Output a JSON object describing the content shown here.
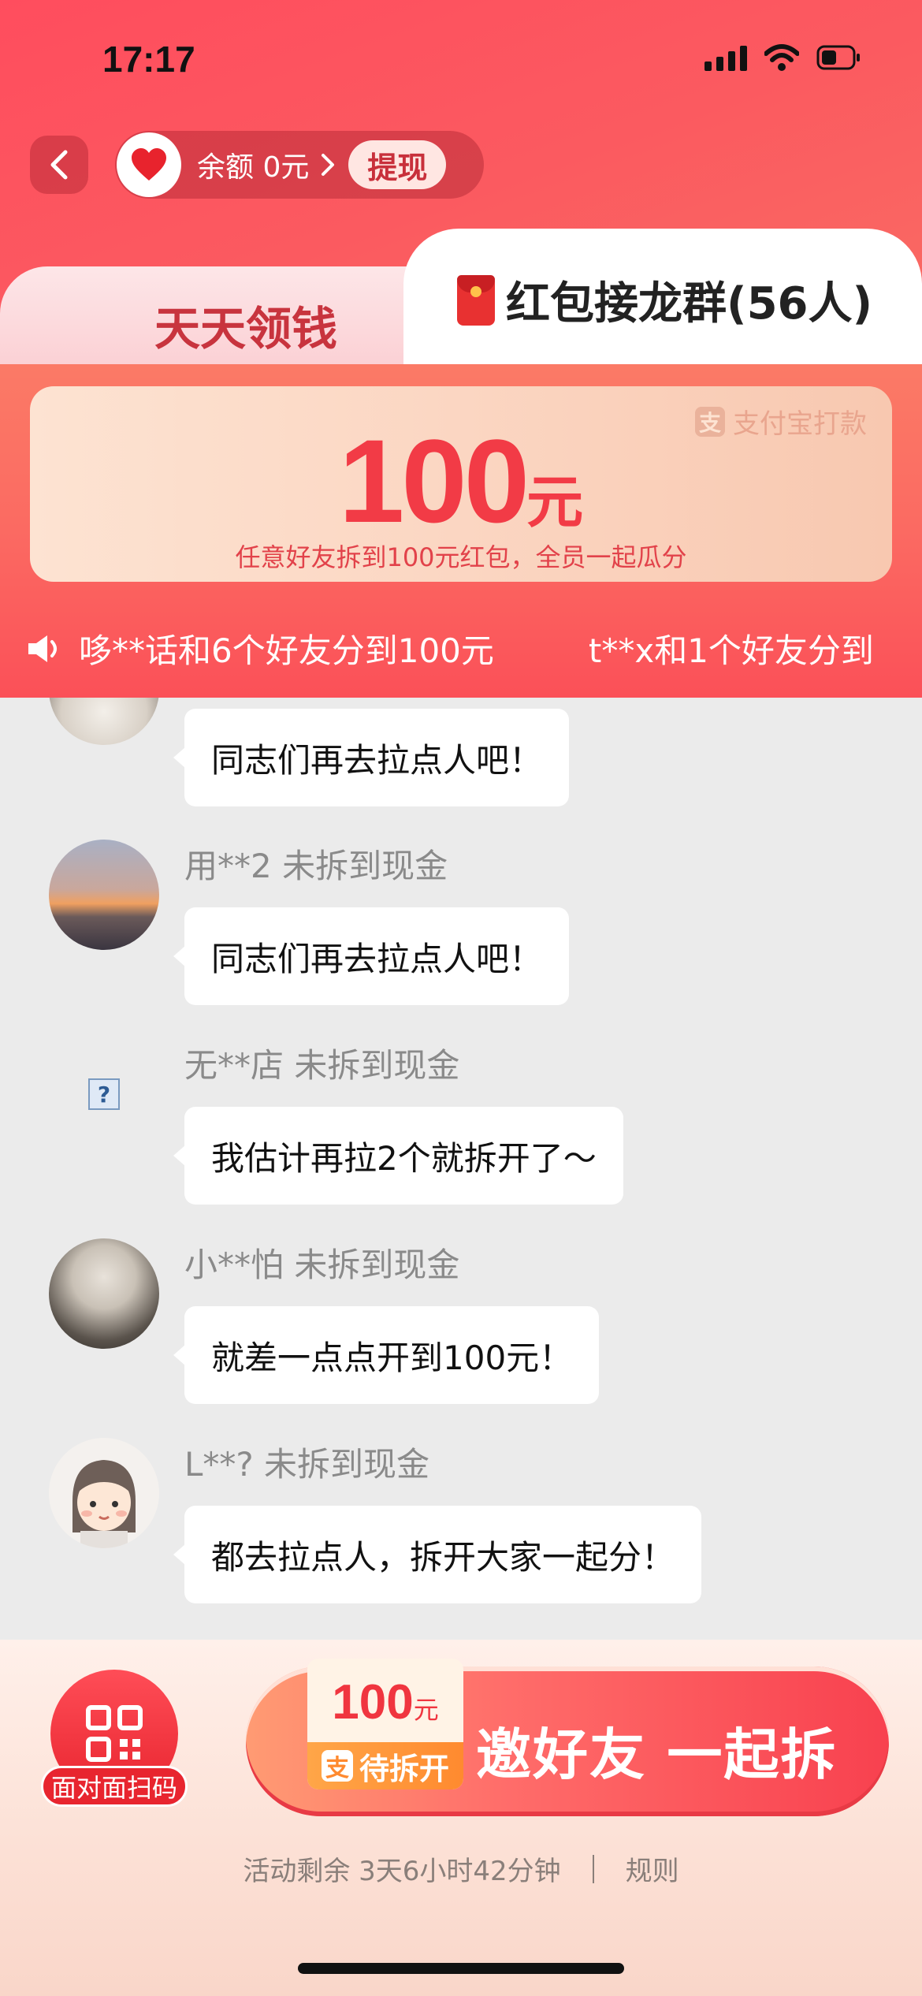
{
  "status_bar": {
    "time": "17:17"
  },
  "header": {
    "balance_prefix": "余额",
    "balance_amount": "0",
    "balance_unit": "元",
    "withdraw_label": "提现"
  },
  "tabs": {
    "left_label": "天天领钱",
    "right_label": "红包接龙群(56人)"
  },
  "prize": {
    "payment_tag": "支付宝打款",
    "amount": "100",
    "unit": "元",
    "description": "任意好友拆到100元红包，全员一起瓜分"
  },
  "ticker": {
    "messages": [
      "哆**话和6个好友分到100元",
      "t**x和1个好友分到"
    ]
  },
  "chat": {
    "messages": [
      {
        "user": "",
        "text": "同志们再去拉点人吧！"
      },
      {
        "user": "用**2 未拆到现金",
        "text": "同志们再去拉点人吧！"
      },
      {
        "user": "无**店 未拆到现金",
        "text": "我估计再拉2个就拆开了～"
      },
      {
        "user": "小**怕 未拆到现金",
        "text": "就差一点点开到100元！"
      },
      {
        "user": "L**? 未拆到现金",
        "text": "都去拉点人，拆开大家一起分！"
      }
    ]
  },
  "footer": {
    "scan_label": "面对面扫码",
    "pending_amount": "100",
    "pending_unit": "元",
    "pending_status": "待拆开",
    "invite_label": "邀好友 一起拆",
    "countdown": "活动剩余 3天6小时42分钟",
    "rules_label": "规则"
  },
  "colors": {
    "brand_red": "#f23b46",
    "header_gradient_start": "#ff4d5e",
    "header_gradient_end": "#f87e67",
    "pending_orange": "#ff8a2f"
  }
}
